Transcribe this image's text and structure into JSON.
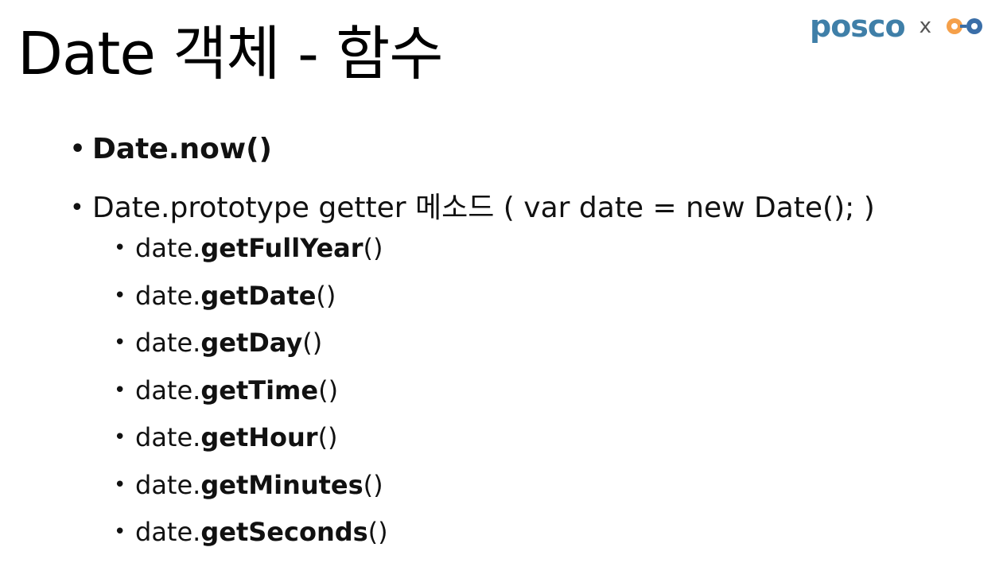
{
  "slide": {
    "title": "Date 객체 - 함수"
  },
  "logo": {
    "brand": "posco",
    "separator": "x",
    "partner_icon": "orange-circle-logo-icon",
    "colors": {
      "posco": "#3f7fa8",
      "partner_orange": "#f5a04a",
      "partner_blue": "#3a6ea8"
    }
  },
  "bullets": [
    {
      "text": "Date.now()"
    },
    {
      "text": "Date.prototype getter 메소드 ( var date = new Date(); )"
    }
  ],
  "methods": [
    {
      "prefix": "date.",
      "name": "getFullYear",
      "suffix": "()"
    },
    {
      "prefix": "date.",
      "name": "getDate",
      "suffix": "()"
    },
    {
      "prefix": "date.",
      "name": "getDay",
      "suffix": "()"
    },
    {
      "prefix": "date.",
      "name": "getTime",
      "suffix": "()"
    },
    {
      "prefix": "date.",
      "name": "getHour",
      "suffix": "()"
    },
    {
      "prefix": "date.",
      "name": "getMinutes",
      "suffix": "()"
    },
    {
      "prefix": "date.",
      "name": "getSeconds",
      "suffix": "()"
    }
  ]
}
